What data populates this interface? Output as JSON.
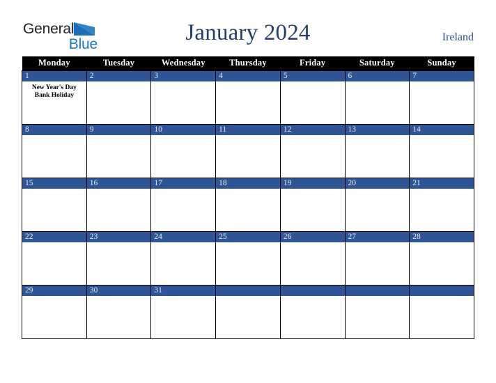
{
  "brand": {
    "name_part1": "General",
    "name_part2": "Blue",
    "triangle_icon": "triangle-icon",
    "color_dark": "#231f20",
    "color_blue": "#1b7cc4"
  },
  "header": {
    "title": "January 2024",
    "country": "Ireland",
    "title_color": "#27406b"
  },
  "calendar": {
    "accent_blue": "#2f5596",
    "header_background": "#000000",
    "weekdays": [
      "Monday",
      "Tuesday",
      "Wednesday",
      "Thursday",
      "Friday",
      "Saturday",
      "Sunday"
    ],
    "weeks": [
      [
        {
          "day": "1",
          "events": [
            "New Year's Day",
            "Bank Holiday"
          ]
        },
        {
          "day": "2",
          "events": []
        },
        {
          "day": "3",
          "events": []
        },
        {
          "day": "4",
          "events": []
        },
        {
          "day": "5",
          "events": []
        },
        {
          "day": "6",
          "events": []
        },
        {
          "day": "7",
          "events": []
        }
      ],
      [
        {
          "day": "8",
          "events": []
        },
        {
          "day": "9",
          "events": []
        },
        {
          "day": "10",
          "events": []
        },
        {
          "day": "11",
          "events": []
        },
        {
          "day": "12",
          "events": []
        },
        {
          "day": "13",
          "events": []
        },
        {
          "day": "14",
          "events": []
        }
      ],
      [
        {
          "day": "15",
          "events": []
        },
        {
          "day": "16",
          "events": []
        },
        {
          "day": "17",
          "events": []
        },
        {
          "day": "18",
          "events": []
        },
        {
          "day": "19",
          "events": []
        },
        {
          "day": "20",
          "events": []
        },
        {
          "day": "21",
          "events": []
        }
      ],
      [
        {
          "day": "22",
          "events": []
        },
        {
          "day": "23",
          "events": []
        },
        {
          "day": "24",
          "events": []
        },
        {
          "day": "25",
          "events": []
        },
        {
          "day": "26",
          "events": []
        },
        {
          "day": "27",
          "events": []
        },
        {
          "day": "28",
          "events": []
        }
      ],
      [
        {
          "day": "29",
          "events": []
        },
        {
          "day": "30",
          "events": []
        },
        {
          "day": "31",
          "events": []
        },
        {
          "day": "",
          "events": []
        },
        {
          "day": "",
          "events": []
        },
        {
          "day": "",
          "events": []
        },
        {
          "day": "",
          "events": []
        }
      ]
    ]
  }
}
